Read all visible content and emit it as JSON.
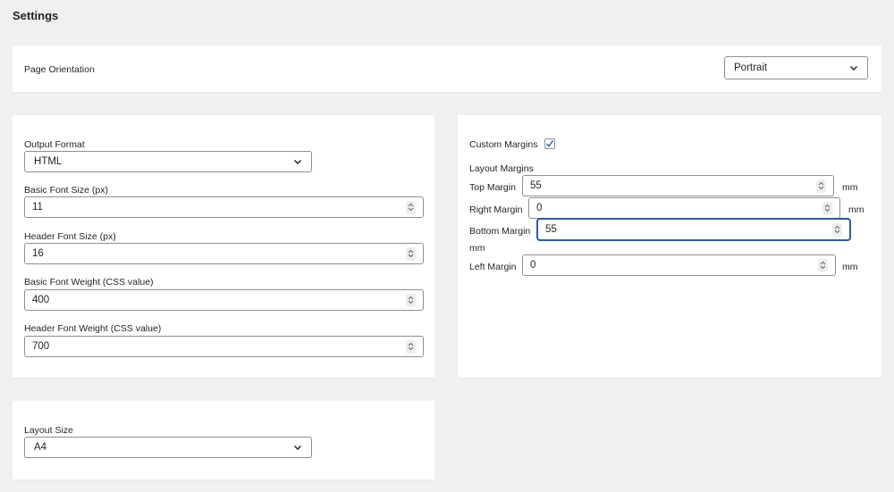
{
  "page": {
    "title": "Settings"
  },
  "orientation": {
    "label": "Page Orientation",
    "value": "Portrait"
  },
  "format_panel": {
    "output_format": {
      "label": "Output Format",
      "value": "HTML"
    },
    "basic_font_size": {
      "label": "Basic Font Size (px)",
      "value": "11"
    },
    "header_font_size": {
      "label": "Header Font Size (px)",
      "value": "16"
    },
    "basic_font_weight": {
      "label": "Basic Font Weight (CSS value)",
      "value": "400"
    },
    "header_font_weight": {
      "label": "Header Font Weight (CSS value)",
      "value": "700"
    }
  },
  "margins_panel": {
    "custom_margins": {
      "label": "Custom Margins",
      "checked": true
    },
    "layout_margins_label": "Layout Margins",
    "top": {
      "label": "Top Margin",
      "value": "55",
      "unit": "mm"
    },
    "right": {
      "label": "Right Margin",
      "value": "0",
      "unit": "mm"
    },
    "bottom": {
      "label": "Bottom Margin",
      "value": "55",
      "unit": "mm"
    },
    "left": {
      "label": "Left Margin",
      "value": "0",
      "unit": "mm"
    }
  },
  "layout_panel": {
    "layout_size": {
      "label": "Layout Size",
      "value": "A4"
    }
  },
  "colors": {
    "background": "#f0f0f1",
    "panel": "#ffffff",
    "focus": "#2c5aa0",
    "border": "#8c8f94"
  }
}
